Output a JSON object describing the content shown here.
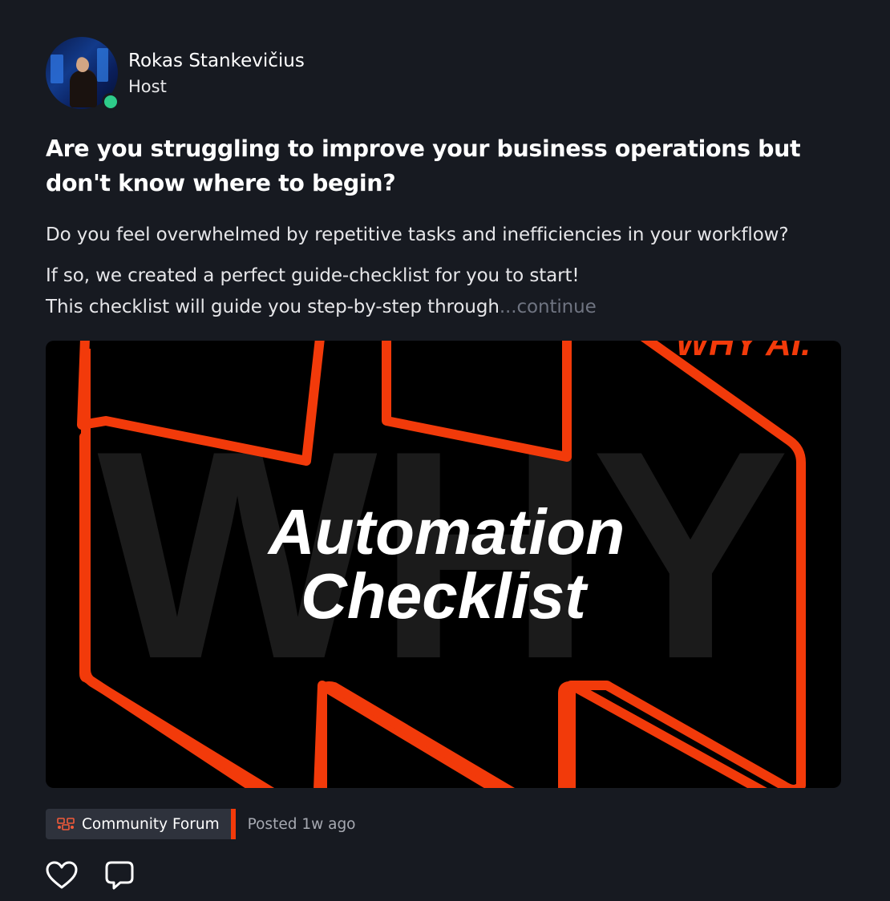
{
  "post": {
    "author": {
      "name": "Rokas Stankevičius",
      "role": "Host",
      "online": true
    },
    "title": "Are you struggling to improve your business operations but don't know where to begin?",
    "body": [
      "Do you feel overwhelmed by repetitive tasks and inefficiencies in your workflow?",
      "If so, we created a perfect guide-checklist for you to start!",
      "This checklist will guide you step-by-step through"
    ],
    "continue_label": "...continue",
    "banner": {
      "heading_line1": "Automation",
      "heading_line2": "Checklist",
      "corner_text": "WHY AI.",
      "watermark_text": "WHY",
      "accent_color": "#f23a0a"
    },
    "category": {
      "label": "Community Forum",
      "icon": "community-forum-icon"
    },
    "posted": "Posted 1w ago",
    "actions": {
      "like_icon": "heart-icon",
      "comment_icon": "comment-icon"
    }
  },
  "colors": {
    "background": "#171a21",
    "accent": "#f23a0a",
    "online": "#2ecc8a",
    "muted": "#6f7481"
  }
}
